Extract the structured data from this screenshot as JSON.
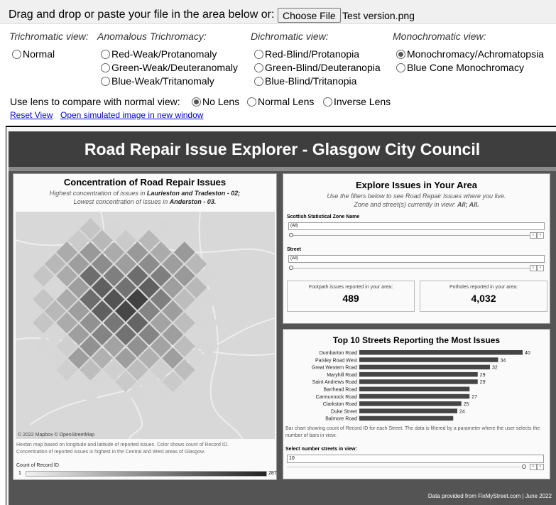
{
  "upload": {
    "prompt": "Drag and drop or paste your file in the area below or:",
    "button_label": "Choose File",
    "file_name": "Test version.png"
  },
  "groups": {
    "trichromatic": {
      "heading": "Trichromatic view:",
      "options": [
        "Normal"
      ]
    },
    "anomalous": {
      "heading": "Anomalous Trichromacy:",
      "options": [
        "Red-Weak/Protanomaly",
        "Green-Weak/Deuteranomaly",
        "Blue-Weak/Tritanomaly"
      ]
    },
    "dichromatic": {
      "heading": "Dichromatic view:",
      "options": [
        "Red-Blind/Protanopia",
        "Green-Blind/Deuteranopia",
        "Blue-Blind/Tritanopia"
      ]
    },
    "monochromatic": {
      "heading": "Monochromatic view:",
      "options": [
        "Monochromacy/Achromatopsia",
        "Blue Cone Monochromacy"
      ],
      "selected": "Monochromacy/Achromatopsia"
    }
  },
  "lens": {
    "label": "Use lens to compare with normal view:",
    "options": [
      "No Lens",
      "Normal Lens",
      "Inverse Lens"
    ],
    "selected": "No Lens"
  },
  "links": {
    "reset": "Reset View",
    "open_new": "Open simulated image in new window"
  },
  "dashboard": {
    "title": "Road Repair Issue Explorer - Glasgow City Council",
    "footer": "Data provided from FixMyStreet.com | June 2022",
    "map_panel": {
      "title": "Concentration of Road Repair Issues",
      "highest_prefix": "Highest concentration of issues in",
      "highest_area": "Laurieston and Tradeston - 02;",
      "lowest_prefix": "Lowest concentration of issues in",
      "lowest_area": "Anderston - 03.",
      "credit": "© 2022 Mapbox © OpenStreetMap",
      "note1": "Hexbin map based on longitude and latitude of reported issues.  Color shows count of Record ID.",
      "note2": "Concentration of reported issues is highest in the Central and West areas of Glasgow.",
      "legend_title": "Count of Record ID",
      "legend_min": "1",
      "legend_max": "287"
    },
    "explore_panel": {
      "title": "Explore Issues in Your Area",
      "sub1": "Use the filters below to see Road Repair Issues where you live.",
      "sub2_prefix": "Zone and street(s) currently in view:",
      "sub2_value": "All; All.",
      "zone_label": "Scottish Statistical Zone Name",
      "zone_value": "(All)",
      "street_label": "Street",
      "street_value": "(All)",
      "footpath_label": "Footpath issues reported in your area:",
      "footpath_value": "489",
      "potholes_label": "Potholes reported in your area:",
      "potholes_value": "4,032"
    },
    "bar_panel": {
      "title": "Top 10 Streets Reporting the Most Issues",
      "note": "Bar chart showing count of Record ID for each Street. The data is filtered by a parameter where the user selects the number of bars in view.",
      "select_label": "Select number streets in view:",
      "select_value": "10"
    }
  },
  "chart_data": {
    "type": "bar",
    "title": "Top 10 Streets Reporting the Most Issues",
    "xlabel": "",
    "ylabel": "",
    "categories": [
      "Dumbarton Road",
      "Paisley Road West",
      "Great Western Road",
      "Maryhill Road",
      "Saint Andrews Road",
      "Barrhead Road",
      "Carmunnock Road",
      "Clarkston Road",
      "Duke Street",
      "Balmore Road"
    ],
    "values": [
      40,
      34,
      32,
      29,
      29,
      27,
      27,
      25,
      24,
      23
    ],
    "labels_shown": [
      "40",
      "34",
      "32",
      "29",
      "29",
      "",
      "27",
      "25",
      "24",
      ""
    ],
    "xlim": [
      0,
      40
    ]
  }
}
